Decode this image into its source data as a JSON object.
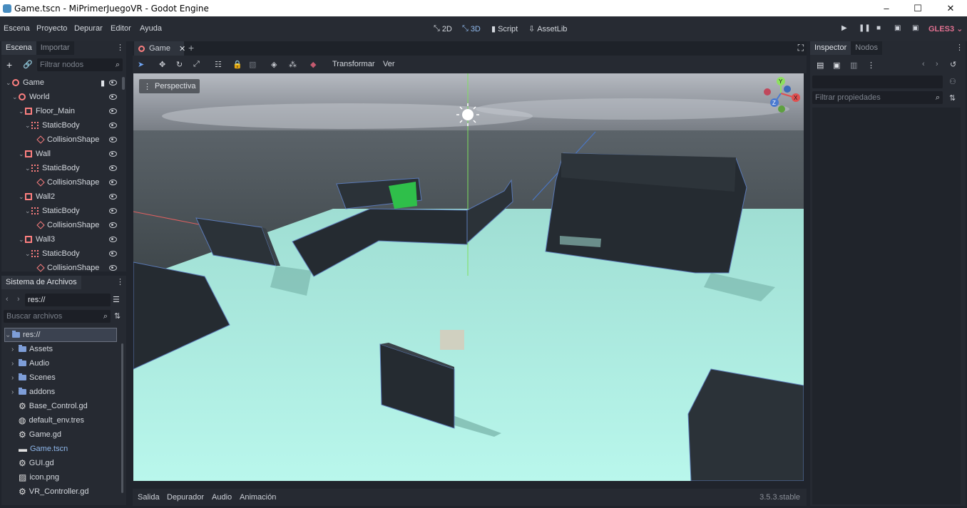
{
  "window": {
    "title": "Game.tscn - MiPrimerJuegoVR - Godot Engine",
    "controls": [
      "–",
      "☐",
      "✕"
    ]
  },
  "menubar": {
    "items": [
      "Escena",
      "Proyecto",
      "Depurar",
      "Editor",
      "Ayuda"
    ],
    "modes": [
      {
        "label": "2D",
        "icon": "2d-icon"
      },
      {
        "label": "3D",
        "icon": "3d-icon"
      },
      {
        "label": "Script",
        "icon": "script-icon"
      },
      {
        "label": "AssetLib",
        "icon": "assetlib-icon"
      }
    ],
    "renderer": "GLES3"
  },
  "scene_dock": {
    "tabs": [
      "Escena",
      "Importar"
    ],
    "filter_placeholder": "Filtrar nodos",
    "nodes": [
      {
        "name": "Game",
        "depth": 0,
        "type": "node3d"
      },
      {
        "name": "World",
        "depth": 1,
        "type": "node3d"
      },
      {
        "name": "Floor_Main",
        "depth": 2,
        "type": "mesh"
      },
      {
        "name": "StaticBody",
        "depth": 3,
        "type": "static"
      },
      {
        "name": "CollisionShape",
        "depth": 4,
        "type": "shape"
      },
      {
        "name": "Wall",
        "depth": 2,
        "type": "mesh"
      },
      {
        "name": "StaticBody",
        "depth": 3,
        "type": "static"
      },
      {
        "name": "CollisionShape",
        "depth": 4,
        "type": "shape"
      },
      {
        "name": "Wall2",
        "depth": 2,
        "type": "mesh"
      },
      {
        "name": "StaticBody",
        "depth": 3,
        "type": "static"
      },
      {
        "name": "CollisionShape",
        "depth": 4,
        "type": "shape"
      },
      {
        "name": "Wall3",
        "depth": 2,
        "type": "mesh"
      },
      {
        "name": "StaticBody",
        "depth": 3,
        "type": "static"
      },
      {
        "name": "CollisionShape",
        "depth": 4,
        "type": "shape"
      }
    ]
  },
  "filesystem_dock": {
    "title": "Sistema de Archivos",
    "path": "res://",
    "search_placeholder": "Buscar archivos",
    "items": [
      {
        "name": "res://",
        "kind": "root"
      },
      {
        "name": "Assets",
        "kind": "folder"
      },
      {
        "name": "Audio",
        "kind": "folder"
      },
      {
        "name": "Scenes",
        "kind": "folder"
      },
      {
        "name": "addons",
        "kind": "folder"
      },
      {
        "name": "Base_Control.gd",
        "kind": "script"
      },
      {
        "name": "default_env.tres",
        "kind": "env"
      },
      {
        "name": "Game.gd",
        "kind": "script"
      },
      {
        "name": "Game.tscn",
        "kind": "scene"
      },
      {
        "name": "GUI.gd",
        "kind": "script"
      },
      {
        "name": "icon.png",
        "kind": "image"
      },
      {
        "name": "VR_Controller.gd",
        "kind": "script"
      }
    ]
  },
  "viewport": {
    "scene_tab": "Game",
    "toolbar_menus": [
      "Transformar",
      "Ver"
    ],
    "view_label": "Perspectiva",
    "gizmo_axes": [
      "Y",
      "X",
      "Z"
    ]
  },
  "inspector": {
    "tabs": [
      "Inspector",
      "Nodos"
    ],
    "filter_placeholder": "Filtrar propiedades"
  },
  "bottom_panel": {
    "tabs": [
      "Salida",
      "Depurador",
      "Audio",
      "Animación"
    ],
    "version": "3.5.3.stable"
  },
  "colors": {
    "accent": "#8fb8ec",
    "floor": "#a7ece0",
    "renderer": "#e07090",
    "node_icon": "#fc7f7f"
  }
}
